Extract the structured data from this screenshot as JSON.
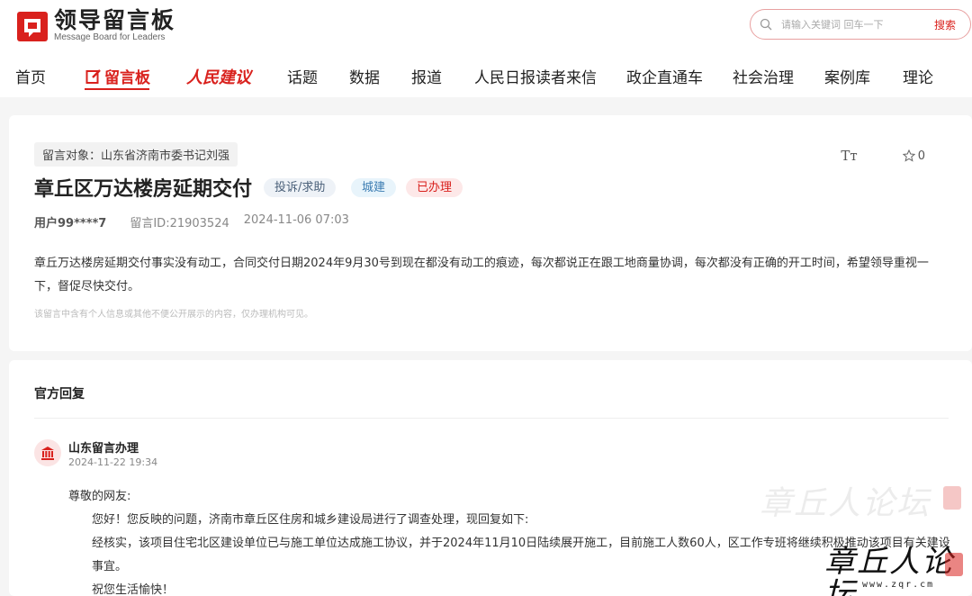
{
  "site": {
    "logo_title": "领导留言板",
    "logo_subtitle": "Message Board for Leaders",
    "brand_color": "#d9211d"
  },
  "search": {
    "placeholder": "请输入关键词 回车一下",
    "button_label": "搜索"
  },
  "nav": {
    "items": [
      "首页",
      "留言板",
      "人民建议",
      "话题",
      "数据",
      "报道",
      "人民日报读者来信",
      "政企直通车",
      "社会治理",
      "案例库",
      "理论"
    ],
    "active_index": 1
  },
  "post": {
    "target": "留言对象：山东省济南市委书记刘强",
    "title": "章丘区万达楼房延期交付",
    "type_badge": "投诉/求助",
    "field_badge": "城建",
    "status_badge": "已办理",
    "user": "用户99****7",
    "message_id": "留言ID:21903524",
    "datetime": "2024-11-06 07:03",
    "favorite_count": "0",
    "font_size_label": "Tт",
    "body": "章丘万达楼房延期交付事实没有动工，合同交付日期2024年9月30号到现在都没有动工的痕迹，每次都说正在跟工地商量协调，每次都没有正确的开工时间，希望领导重视一下，督促尽快交付。",
    "privacy_note": "该留言中含有个人信息或其他不便公开展示的内容，仅办理机构可见。"
  },
  "reply": {
    "heading": "官方回复",
    "org": "山东留言办理",
    "datetime": "2024-11-22 19:34",
    "greeting": "尊敬的网友:",
    "para1": "您好！您反映的问题，济南市章丘区住房和城乡建设局进行了调查处理，现回复如下:",
    "para2": "经核实，该项目住宅北区建设单位已与施工单位达成施工协议，并于2024年11月10日陆续展开施工，目前施工人数60人，区工作专班将继续积极推动该项目有关建设事宜。",
    "para3": "祝您生活愉快！"
  },
  "watermark": {
    "text": "章丘人论坛",
    "url": "www.zqr.cm"
  }
}
